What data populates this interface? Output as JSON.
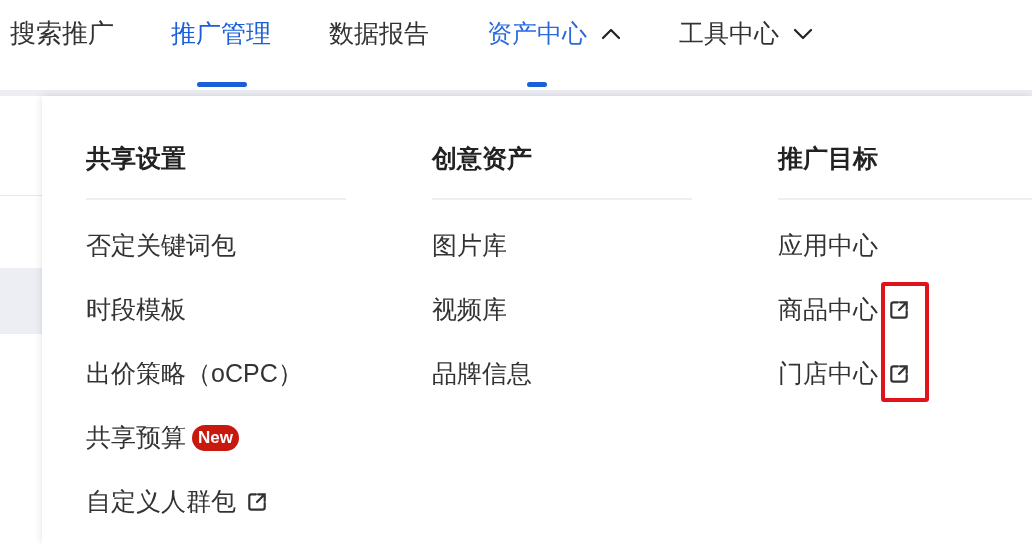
{
  "header": {
    "product": "搜索推广",
    "tabs": [
      {
        "label": "推广管理",
        "kind": "link",
        "selected": true
      },
      {
        "label": "数据报告",
        "kind": "link",
        "selected": false
      },
      {
        "label": "资产中心",
        "kind": "dropdown",
        "selected": false,
        "expanded": true
      },
      {
        "label": "工具中心",
        "kind": "dropdown",
        "selected": false,
        "expanded": false
      }
    ]
  },
  "menu": {
    "columns": [
      {
        "title": "共享设置",
        "items": [
          {
            "label": "否定关键词包",
            "external": false,
            "highlighted": false
          },
          {
            "label": "时段模板",
            "external": false,
            "highlighted": false
          },
          {
            "label": "出价策略（oCPC）",
            "external": false,
            "highlighted": false
          },
          {
            "label": "共享预算",
            "badge": "New",
            "external": false,
            "highlighted": false
          },
          {
            "label": "自定义人群包",
            "external": true,
            "highlighted": false
          }
        ]
      },
      {
        "title": "创意资产",
        "items": [
          {
            "label": "图片库",
            "external": false,
            "highlighted": false
          },
          {
            "label": "视频库",
            "external": false,
            "highlighted": false
          },
          {
            "label": "品牌信息",
            "external": false,
            "highlighted": false
          }
        ]
      },
      {
        "title": "推广目标",
        "items": [
          {
            "label": "应用中心",
            "external": false,
            "highlighted": false
          },
          {
            "label": "商品中心",
            "external": true,
            "highlighted": true
          },
          {
            "label": "门店中心",
            "external": true,
            "highlighted": true
          }
        ]
      }
    ]
  }
}
